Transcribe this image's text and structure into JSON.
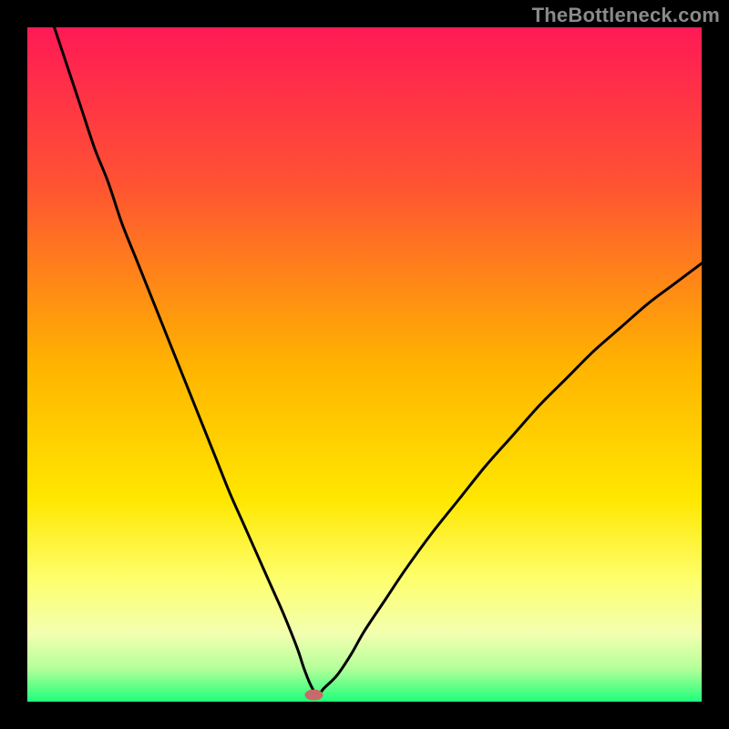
{
  "watermark": "TheBottleneck.com",
  "chart_data": {
    "type": "line",
    "title": "",
    "xlabel": "",
    "ylabel": "",
    "xlim": [
      0,
      100
    ],
    "ylim": [
      0,
      100
    ],
    "grid": false,
    "legend": false,
    "background_gradient": {
      "stops": [
        {
          "offset": 0.0,
          "color": "#ff1a55"
        },
        {
          "offset": 0.23,
          "color": "#ff5233"
        },
        {
          "offset": 0.5,
          "color": "#ffb300"
        },
        {
          "offset": 0.7,
          "color": "#ffe700"
        },
        {
          "offset": 0.82,
          "color": "#fdff6e"
        },
        {
          "offset": 0.9,
          "color": "#f2ffb0"
        },
        {
          "offset": 0.95,
          "color": "#b6ff9a"
        },
        {
          "offset": 1.0,
          "color": "#1eff7a"
        }
      ]
    },
    "series": [
      {
        "name": "bottleneck-curve",
        "x": [
          4,
          6,
          8,
          10,
          12,
          14,
          16,
          18,
          20,
          22,
          24,
          26,
          28,
          30,
          32,
          34,
          36,
          38,
          40,
          41,
          42,
          43,
          44,
          46,
          48,
          50,
          53,
          56,
          60,
          64,
          68,
          72,
          76,
          80,
          84,
          88,
          92,
          96,
          100
        ],
        "y": [
          100,
          94,
          88,
          82,
          77,
          71,
          66,
          61,
          56,
          51,
          46,
          41,
          36,
          31,
          26.5,
          22,
          17.5,
          13,
          8,
          5,
          2.5,
          1,
          2,
          4,
          7,
          10.5,
          15,
          19.5,
          25,
          30,
          35,
          39.5,
          44,
          48,
          52,
          55.5,
          59,
          62,
          65
        ]
      }
    ],
    "marker": {
      "name": "min-point-marker",
      "x": 42.5,
      "y": 1.0,
      "color": "#c96a6a",
      "rx": 10,
      "ry": 6
    }
  }
}
